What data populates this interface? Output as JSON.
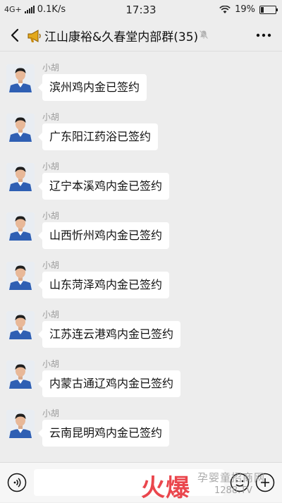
{
  "status_bar": {
    "network": "4G+",
    "speed": "0.1K/s",
    "time": "17:33",
    "battery": "19%",
    "battery_level": 0.19
  },
  "header": {
    "title": "江山康裕&久春堂内部群(35)",
    "back_icon": "chevron-left-icon",
    "group_icon": "megaphone-icon",
    "mute_icon": "muted-bell-icon",
    "more_icon": "more-dots-icon"
  },
  "messages": [
    {
      "sender": "小胡",
      "text": "滨州鸡内金已签约"
    },
    {
      "sender": "小胡",
      "text": "广东阳江药浴已签约"
    },
    {
      "sender": "小胡",
      "text": "辽宁本溪鸡内金已签约"
    },
    {
      "sender": "小胡",
      "text": "山西忻州鸡内金已签约"
    },
    {
      "sender": "小胡",
      "text": "山东菏泽鸡内金已签约"
    },
    {
      "sender": "小胡",
      "text": "江苏连云港鸡内金已签约"
    },
    {
      "sender": "小胡",
      "text": "内蒙古通辽鸡内金已签约"
    },
    {
      "sender": "小胡",
      "text": "云南昆明鸡内金已签约"
    }
  ],
  "input_bar": {
    "value": "",
    "placeholder": "",
    "voice_icon": "voice-icon",
    "emoji_icon": "emoji-icon",
    "plus_icon": "plus-icon"
  },
  "watermark": {
    "logo": "火爆",
    "title": "孕婴童招商网",
    "url": "1288.TV"
  },
  "colors": {
    "background": "#ededed",
    "bubble": "#ffffff",
    "watermark_red": "#e8333a"
  }
}
